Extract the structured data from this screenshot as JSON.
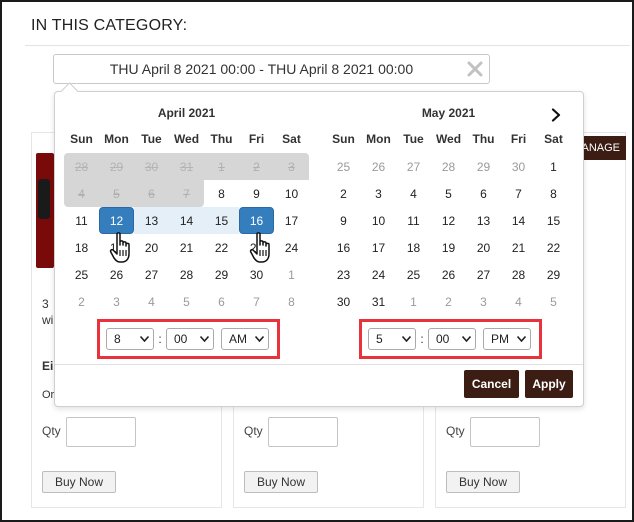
{
  "section_title": "IN THIS CATEGORY:",
  "date_range": {
    "value": "THU April 8 2021 00:00 - THU April 8 2021 00:00"
  },
  "product_cards": [
    {
      "frag1": "3",
      "frag2": "wi",
      "frag3": "Ei",
      "frag4": "Or",
      "qty_label": "Qty",
      "buy_label": "Buy Now"
    },
    {
      "qty_label": "Qty",
      "buy_label": "Buy Now"
    },
    {
      "qty_label": "Qty",
      "buy_label": "Buy Now",
      "manage_label": "ANAGE"
    }
  ],
  "weekday_labels": [
    "Sun",
    "Mon",
    "Tue",
    "Wed",
    "Thu",
    "Fri",
    "Sat"
  ],
  "calendars": [
    {
      "month": "April 2021",
      "weeks": [
        [
          {
            "d": "28",
            "s": "dis off"
          },
          {
            "d": "29",
            "s": "dis off"
          },
          {
            "d": "30",
            "s": "dis off"
          },
          {
            "d": "31",
            "s": "dis off"
          },
          {
            "d": "1",
            "s": "dis"
          },
          {
            "d": "2",
            "s": "dis"
          },
          {
            "d": "3",
            "s": "dis"
          }
        ],
        [
          {
            "d": "4",
            "s": "dis"
          },
          {
            "d": "5",
            "s": "dis"
          },
          {
            "d": "6",
            "s": "dis"
          },
          {
            "d": "7",
            "s": "dis"
          },
          {
            "d": "8",
            "s": ""
          },
          {
            "d": "9",
            "s": ""
          },
          {
            "d": "10",
            "s": ""
          }
        ],
        [
          {
            "d": "11",
            "s": ""
          },
          {
            "d": "12",
            "s": "sel"
          },
          {
            "d": "13",
            "s": "range"
          },
          {
            "d": "14",
            "s": "range"
          },
          {
            "d": "15",
            "s": "range"
          },
          {
            "d": "16",
            "s": "sel"
          },
          {
            "d": "17",
            "s": ""
          }
        ],
        [
          {
            "d": "18",
            "s": ""
          },
          {
            "d": "19",
            "s": ""
          },
          {
            "d": "20",
            "s": ""
          },
          {
            "d": "21",
            "s": ""
          },
          {
            "d": "22",
            "s": ""
          },
          {
            "d": "23",
            "s": ""
          },
          {
            "d": "24",
            "s": ""
          }
        ],
        [
          {
            "d": "25",
            "s": ""
          },
          {
            "d": "26",
            "s": ""
          },
          {
            "d": "27",
            "s": ""
          },
          {
            "d": "28",
            "s": ""
          },
          {
            "d": "29",
            "s": ""
          },
          {
            "d": "30",
            "s": ""
          },
          {
            "d": "1",
            "s": "off"
          }
        ],
        [
          {
            "d": "2",
            "s": "off"
          },
          {
            "d": "3",
            "s": "off"
          },
          {
            "d": "4",
            "s": "off"
          },
          {
            "d": "5",
            "s": "off"
          },
          {
            "d": "6",
            "s": "off"
          },
          {
            "d": "7",
            "s": "off"
          },
          {
            "d": "8",
            "s": "off"
          }
        ]
      ],
      "time": {
        "hour": "8",
        "minute": "00",
        "ampm": "AM"
      }
    },
    {
      "month": "May 2021",
      "weeks": [
        [
          {
            "d": "25",
            "s": "off"
          },
          {
            "d": "26",
            "s": "off"
          },
          {
            "d": "27",
            "s": "off"
          },
          {
            "d": "28",
            "s": "off"
          },
          {
            "d": "29",
            "s": "off"
          },
          {
            "d": "30",
            "s": "off"
          },
          {
            "d": "1",
            "s": ""
          }
        ],
        [
          {
            "d": "2",
            "s": ""
          },
          {
            "d": "3",
            "s": ""
          },
          {
            "d": "4",
            "s": ""
          },
          {
            "d": "5",
            "s": ""
          },
          {
            "d": "6",
            "s": ""
          },
          {
            "d": "7",
            "s": ""
          },
          {
            "d": "8",
            "s": ""
          }
        ],
        [
          {
            "d": "9",
            "s": ""
          },
          {
            "d": "10",
            "s": ""
          },
          {
            "d": "11",
            "s": ""
          },
          {
            "d": "12",
            "s": ""
          },
          {
            "d": "13",
            "s": ""
          },
          {
            "d": "14",
            "s": ""
          },
          {
            "d": "15",
            "s": ""
          }
        ],
        [
          {
            "d": "16",
            "s": ""
          },
          {
            "d": "17",
            "s": ""
          },
          {
            "d": "18",
            "s": ""
          },
          {
            "d": "19",
            "s": ""
          },
          {
            "d": "20",
            "s": ""
          },
          {
            "d": "21",
            "s": ""
          },
          {
            "d": "22",
            "s": ""
          }
        ],
        [
          {
            "d": "23",
            "s": ""
          },
          {
            "d": "24",
            "s": ""
          },
          {
            "d": "25",
            "s": ""
          },
          {
            "d": "26",
            "s": ""
          },
          {
            "d": "27",
            "s": ""
          },
          {
            "d": "28",
            "s": ""
          },
          {
            "d": "29",
            "s": ""
          }
        ],
        [
          {
            "d": "30",
            "s": ""
          },
          {
            "d": "31",
            "s": ""
          },
          {
            "d": "1",
            "s": "off"
          },
          {
            "d": "2",
            "s": "off"
          },
          {
            "d": "3",
            "s": "off"
          },
          {
            "d": "4",
            "s": "off"
          },
          {
            "d": "5",
            "s": "off"
          }
        ]
      ],
      "time": {
        "hour": "5",
        "minute": "00",
        "ampm": "PM"
      }
    }
  ],
  "buttons": {
    "cancel": "Cancel",
    "apply": "Apply"
  },
  "icons": {
    "clear": "close-icon",
    "next": "chevron-right-icon",
    "cursor": "hand-pointer-icon",
    "caret": "chevron-down-icon"
  },
  "colors": {
    "accent": "#357ebd",
    "range": "#e5eff8",
    "brand_dark": "#3b1d13",
    "highlight_box": "#e8323c",
    "disabled": "#d6d6d6"
  }
}
